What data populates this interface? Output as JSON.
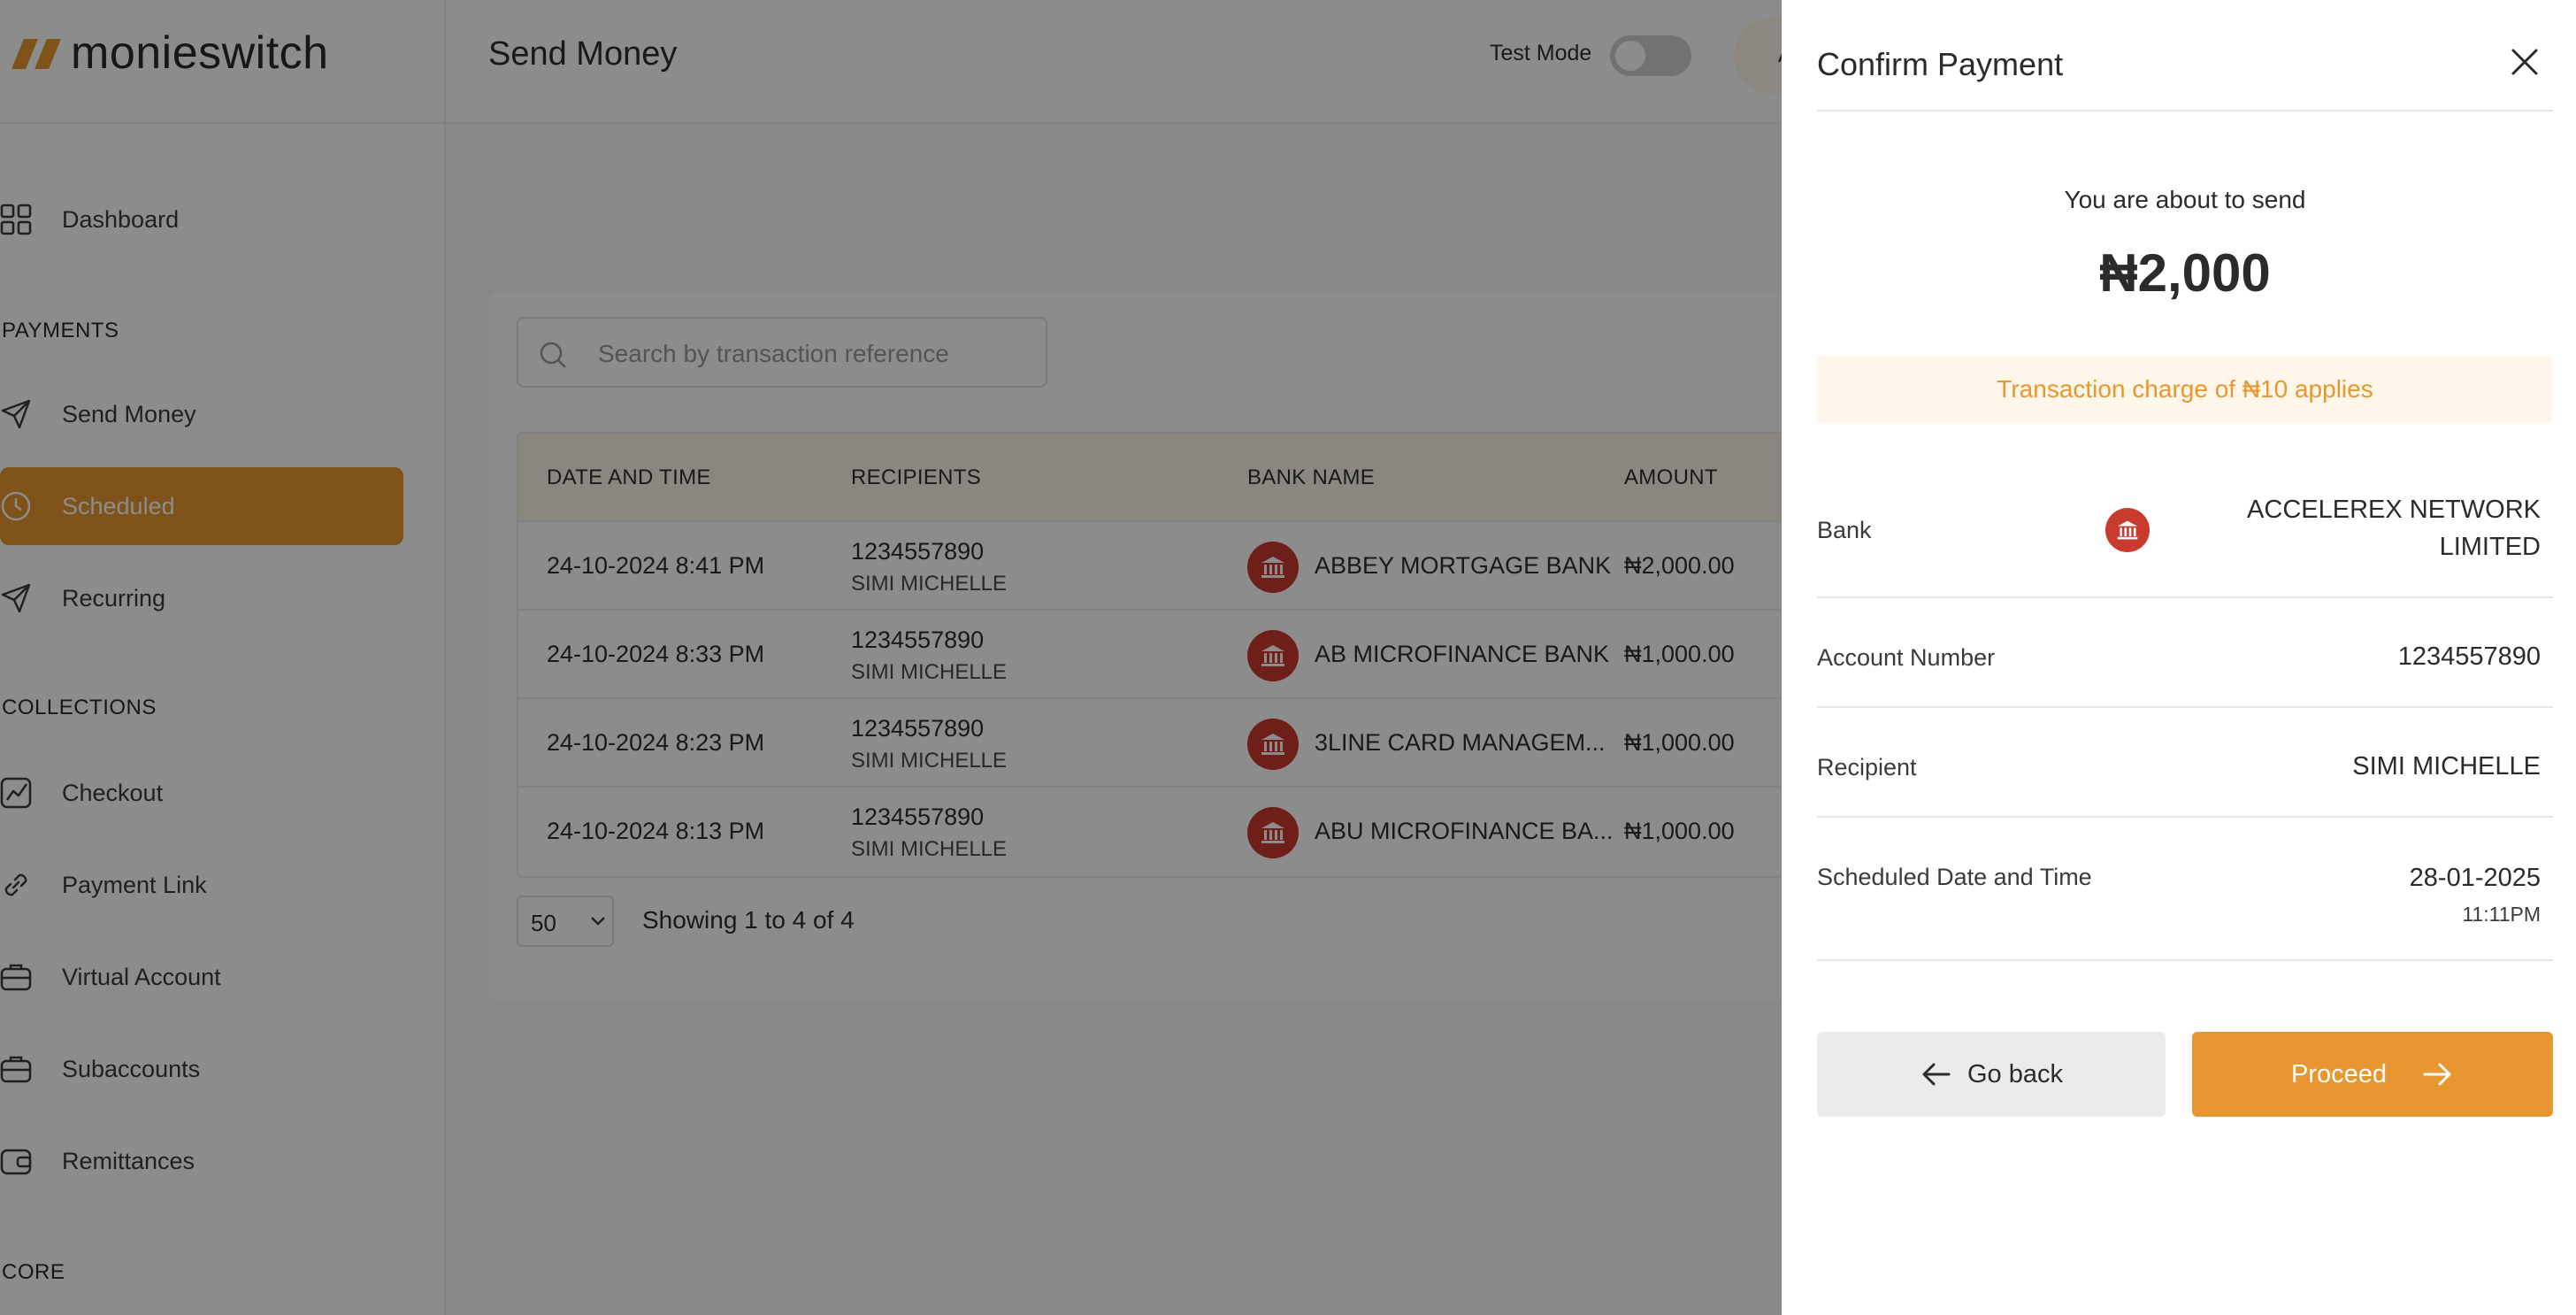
{
  "app": {
    "brand": "monieswitch",
    "accent_color": "#e8962f",
    "bank_icon_color": "#c93a2f"
  },
  "sidebar": {
    "items": [
      {
        "label": "Dashboard",
        "icon": "grid-icon"
      },
      {
        "label": "Send Money",
        "icon": "send-icon"
      },
      {
        "label": "Scheduled",
        "icon": "clock-icon",
        "active": true
      },
      {
        "label": "Recurring",
        "icon": "send-icon"
      },
      {
        "label": "Checkout",
        "icon": "chart-icon"
      },
      {
        "label": "Payment Link",
        "icon": "link-icon"
      },
      {
        "label": "Virtual Account",
        "icon": "briefcase-icon"
      },
      {
        "label": "Subaccounts",
        "icon": "briefcase-icon"
      },
      {
        "label": "Remittances",
        "icon": "wallet-icon"
      }
    ],
    "sections": {
      "payments": "PAYMENTS",
      "collections": "COLLECTIONS",
      "core": "CORE"
    }
  },
  "header": {
    "title": "Send Money",
    "test_mode_label": "Test Mode",
    "test_mode_on": false,
    "avatar_initial": "A"
  },
  "search": {
    "placeholder": "Search by transaction reference"
  },
  "table": {
    "columns": [
      "DATE AND TIME",
      "RECIPIENTS",
      "BANK NAME",
      "AMOUNT"
    ],
    "rows": [
      {
        "date": "24-10-2024 8:41 PM",
        "account": "1234557890",
        "name": "SIMI MICHELLE",
        "bank": "ABBEY MORTGAGE BANK",
        "amount": "₦2,000.00"
      },
      {
        "date": "24-10-2024 8:33 PM",
        "account": "1234557890",
        "name": "SIMI MICHELLE",
        "bank": "AB MICROFINANCE BANK",
        "amount": "₦1,000.00"
      },
      {
        "date": "24-10-2024 8:23 PM",
        "account": "1234557890",
        "name": "SIMI MICHELLE",
        "bank": "3LINE CARD MANAGEM...",
        "amount": "₦1,000.00"
      },
      {
        "date": "24-10-2024 8:13 PM",
        "account": "1234557890",
        "name": "SIMI MICHELLE",
        "bank": "ABU MICROFINANCE BA...",
        "amount": "₦1,000.00"
      }
    ]
  },
  "pagination": {
    "page_size": "50",
    "info": "Showing 1 to 4 of 4"
  },
  "drawer": {
    "title": "Confirm Payment",
    "about_to_send": "You are about to send",
    "amount": "₦2,000",
    "charge_notice": "Transaction charge of ₦10 applies",
    "bank_label": "Bank",
    "bank_value_line1": "ACCELEREX NETWORK",
    "bank_value_line2": "LIMITED",
    "account_label": "Account Number",
    "account_value": "1234557890",
    "recipient_label": "Recipient",
    "recipient_value": "SIMI MICHELLE",
    "scheduled_label": "Scheduled Date and Time",
    "scheduled_date": "28-01-2025",
    "scheduled_time": "11:11PM",
    "back_label": "Go back",
    "proceed_label": "Proceed"
  }
}
